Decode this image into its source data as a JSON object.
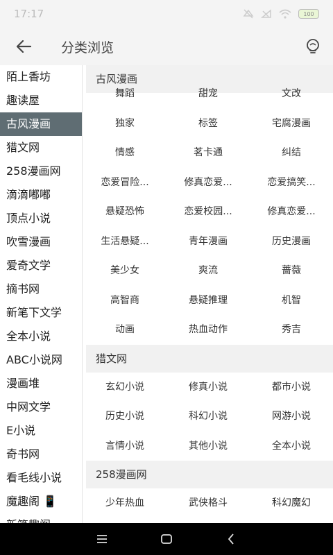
{
  "status": {
    "time": "17:17",
    "battery": "100"
  },
  "header": {
    "title": "分类浏览"
  },
  "sidebar": {
    "items": [
      "陌上香坊",
      "趣读屋",
      "古风漫画",
      "猎文网",
      "258漫画网",
      "滴滴嘟嘟",
      "顶点小说",
      "吹雪漫画",
      "爱奇文学",
      "摘书网",
      "新笔下文学",
      "全本小说",
      "ABC小说网",
      "漫画堆",
      "中网文学",
      "E小说",
      "奇书网",
      "看毛线小说",
      "魔趣阁 📱",
      "新笔趣阁"
    ],
    "active_index": 2
  },
  "sections": [
    {
      "title": "古风漫画",
      "tags": [
        "舞蹈",
        "甜宠",
        "文改",
        "独家",
        "标签",
        "宅腐漫画",
        "情感",
        "茗卡通",
        "纠结",
        "恋爱冒险...",
        "修真恋爱...",
        "恋爱搞笑...",
        "悬疑恐怖",
        "恋爱校园...",
        "修真恋爱...",
        "生活悬疑...",
        "青年漫画",
        "历史漫画",
        "美少女",
        "爽流",
        "蔷薇",
        "高智商",
        "悬疑推理",
        "机智",
        "动画",
        "热血动作",
        "秀吉"
      ]
    },
    {
      "title": "猎文网",
      "tags": [
        "玄幻小说",
        "修真小说",
        "都市小说",
        "历史小说",
        "科幻小说",
        "网游小说",
        "言情小说",
        "其他小说",
        "全本小说"
      ]
    },
    {
      "title": "258漫画网",
      "tags": [
        "少年热血",
        "武侠格斗",
        "科幻魔幻"
      ]
    }
  ],
  "icons": {
    "back": "back-arrow-icon",
    "tip": "lightbulb-icon"
  },
  "colors": {
    "active_bg": "#5f6d73",
    "section_bg": "#f1f1f1"
  }
}
